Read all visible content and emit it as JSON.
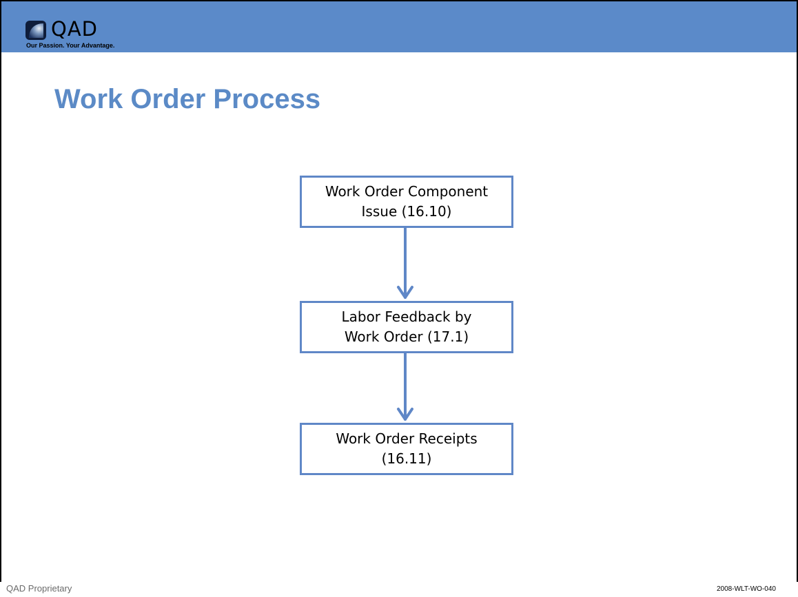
{
  "brand": {
    "logo_text": "QAD",
    "tagline": "Our Passion. Your Advantage.",
    "header_color": "#5b8ac9",
    "accent_color": "#5b8ac6"
  },
  "slide": {
    "title": "Work Order Process"
  },
  "flow": {
    "steps": [
      {
        "label": "Work Order Component\nIssue (16.10)"
      },
      {
        "label": "Labor Feedback by\nWork Order (17.1)"
      },
      {
        "label": "Work Order Receipts\n(16.11)"
      }
    ],
    "connector_color": "#5f87c7"
  },
  "footer": {
    "left_text": "QAD Proprietary",
    "right_text": "2008-WLT-WO-040"
  }
}
